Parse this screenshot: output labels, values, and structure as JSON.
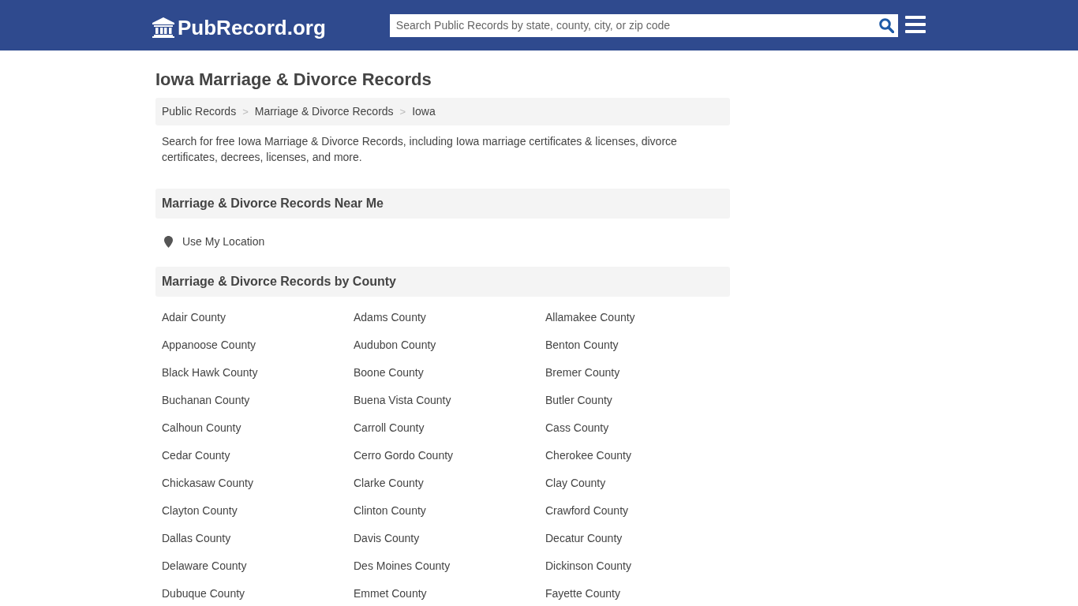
{
  "header": {
    "logo": "PubRecord.org",
    "search": {
      "placeholder": "Search Public Records by state, county, city, or zip code"
    }
  },
  "title": "Iowa Marriage & Divorce Records",
  "breadcrumb": [
    {
      "label": "Public Records",
      "separator": ">"
    },
    {
      "label": "Marriage & Divorce Records",
      "separator": ">"
    },
    {
      "label": "Iowa"
    }
  ],
  "intro": "Search for free Iowa Marriage & Divorce Records, including Iowa marriage certificates & licenses, divorce certificates, decrees, licenses, and more.",
  "near_me": {
    "heading": "Marriage & Divorce Records Near Me",
    "link": "Use My Location"
  },
  "by_county": {
    "heading": "Marriage & Divorce Records by County",
    "items": [
      "Adair County",
      "Adams County",
      "Allamakee County",
      "Appanoose County",
      "Audubon County",
      "Benton County",
      "Black Hawk County",
      "Boone County",
      "Bremer County",
      "Buchanan County",
      "Buena Vista County",
      "Butler County",
      "Calhoun County",
      "Carroll County",
      "Cass County",
      "Cedar County",
      "Cerro Gordo County",
      "Cherokee County",
      "Chickasaw County",
      "Clarke County",
      "Clay County",
      "Clayton County",
      "Clinton County",
      "Crawford County",
      "Dallas County",
      "Davis County",
      "Decatur County",
      "Delaware County",
      "Des Moines County",
      "Dickinson County",
      "Dubuque County",
      "Emmet County",
      "Fayette County"
    ]
  }
}
